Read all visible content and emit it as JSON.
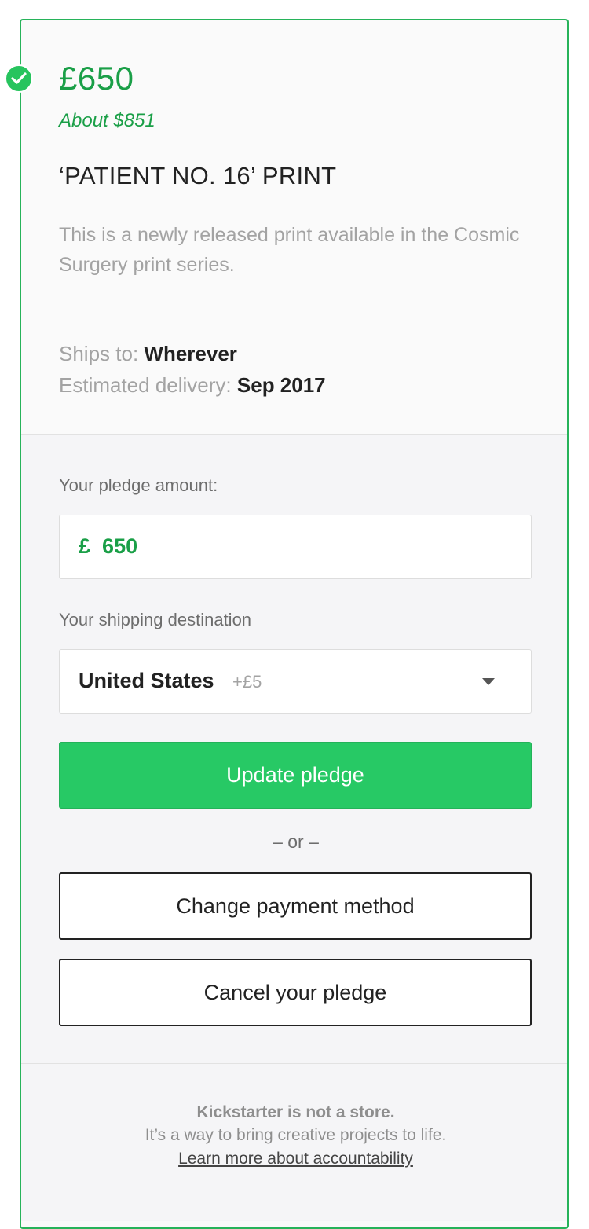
{
  "reward": {
    "price": "£650",
    "converted": "About $851",
    "title": "‘PATIENT NO. 16’ PRINT",
    "description": "This is a newly released print available in the Cosmic Surgery print series.",
    "ships_to_label": "Ships to:",
    "ships_to_value": "Wherever",
    "delivery_label": "Estimated delivery:",
    "delivery_value": "Sep 2017"
  },
  "pledge_form": {
    "amount_label": "Your pledge amount:",
    "currency_symbol": "£",
    "amount_value": "650",
    "shipping_label": "Your shipping destination",
    "shipping_destination": "United States",
    "shipping_cost": "+£5",
    "update_button": "Update pledge",
    "or_text": "– or –",
    "change_payment_button": "Change payment method",
    "cancel_button": "Cancel your pledge"
  },
  "footer": {
    "headline": "Kickstarter is not a store.",
    "text": "It’s a way to bring creative projects to life.",
    "link": "Learn more about accountability"
  },
  "colors": {
    "accent_green": "#1a9f47",
    "button_green": "#27c965",
    "border_green": "#27b35a"
  },
  "icons": {
    "selected": "check-circle-icon",
    "dropdown": "caret-down-icon"
  }
}
